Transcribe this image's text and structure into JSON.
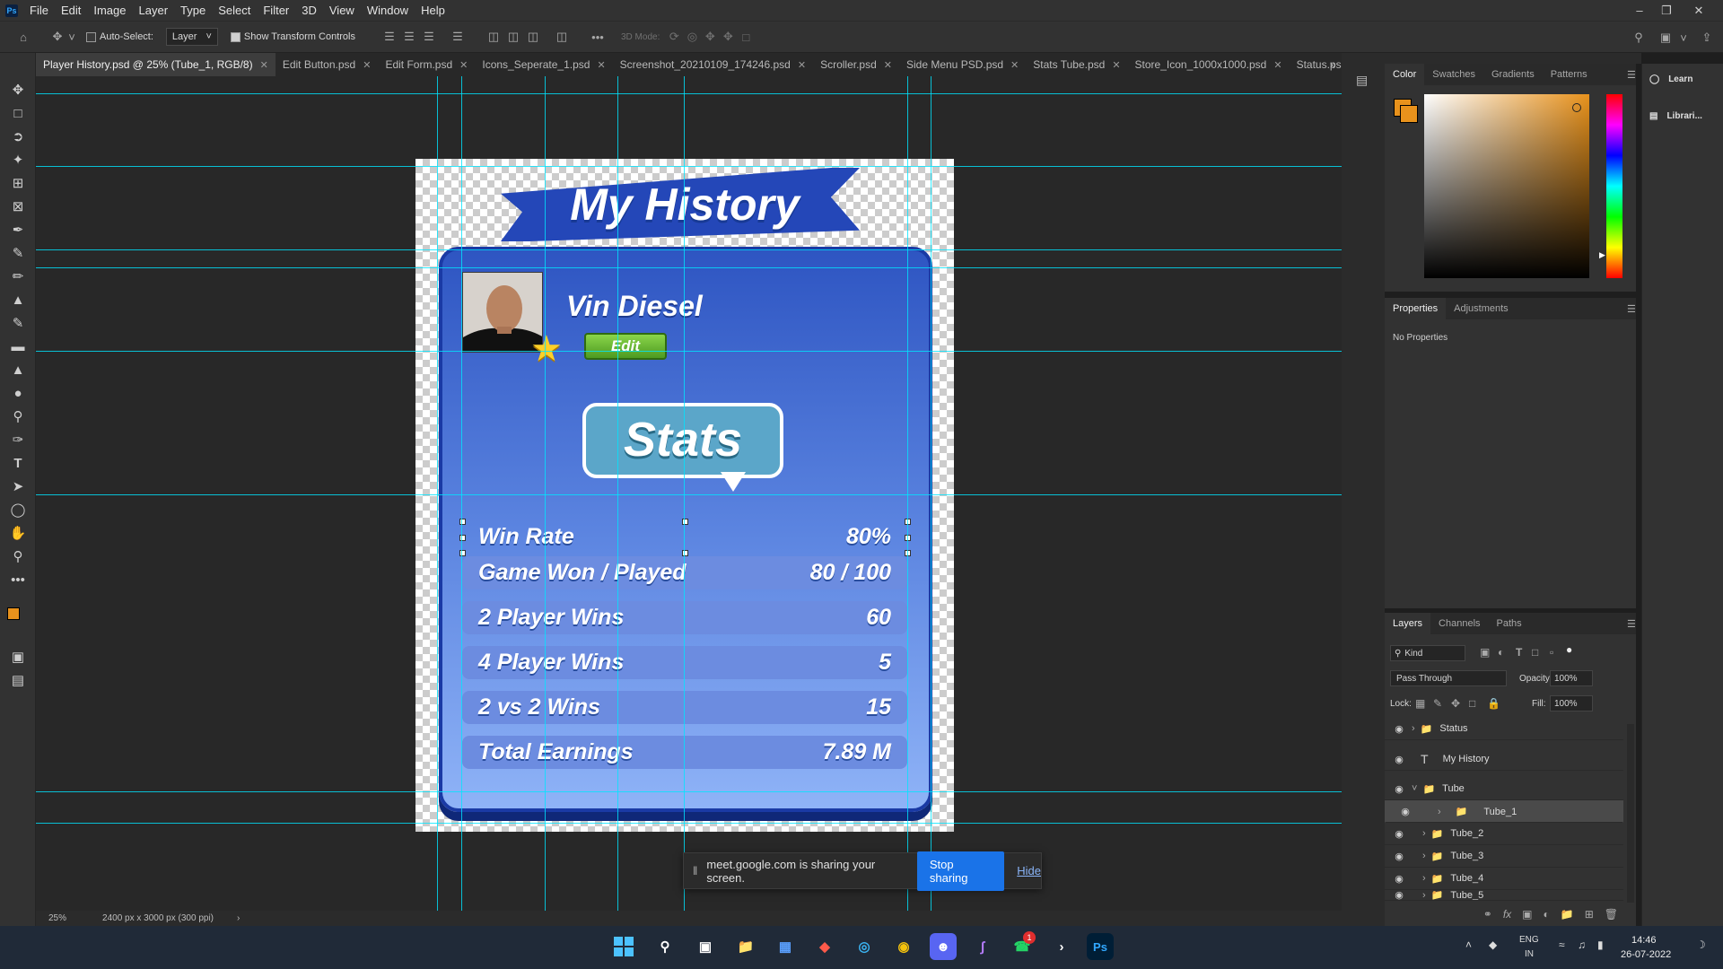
{
  "menubar": {
    "items": [
      "File",
      "Edit",
      "Image",
      "Layer",
      "Type",
      "Select",
      "Filter",
      "3D",
      "View",
      "Window",
      "Help"
    ],
    "logo": "Ps"
  },
  "options": {
    "auto_select_label": "Auto-Select:",
    "auto_select_checked": false,
    "target": "Layer",
    "show_transform_label": "Show Transform Controls",
    "show_transform_checked": true,
    "mode_3d_label": "3D Mode:"
  },
  "tabs": [
    {
      "label": "Player History.psd @ 25% (Tube_1, RGB/8)",
      "active": true
    },
    {
      "label": "Edit Button.psd"
    },
    {
      "label": "Edit Form.psd"
    },
    {
      "label": "Icons_Seperate_1.psd"
    },
    {
      "label": "Screenshot_20210109_174246.psd"
    },
    {
      "label": "Scroller.psd"
    },
    {
      "label": "Side Menu PSD.psd"
    },
    {
      "label": "Stats Tube.psd"
    },
    {
      "label": "Store_Icon_1000x1000.psd"
    },
    {
      "label": "Status.psd"
    }
  ],
  "document": {
    "title": "My History",
    "player_name": "Vin Diesel",
    "edit_label": "Edit",
    "stats_label": "Stats",
    "stats": [
      {
        "label": "Win Rate",
        "value": "80%"
      },
      {
        "label": "Game Won / Played",
        "value": "80 / 100"
      },
      {
        "label": "2 Player Wins",
        "value": "60"
      },
      {
        "label": "4 Player Wins",
        "value": "5"
      },
      {
        "label": "2 vs 2 Wins",
        "value": "15"
      },
      {
        "label": "Total Earnings",
        "value": "7.89 M"
      }
    ]
  },
  "statusbar": {
    "zoom": "25%",
    "doc_size": "2400 px x 3000 px (300 ppi)"
  },
  "color_panel": {
    "tabs": [
      "Color",
      "Swatches",
      "Gradients",
      "Patterns"
    ],
    "foreground": "#e8921c"
  },
  "properties_panel": {
    "tabs": [
      "Properties",
      "Adjustments"
    ],
    "empty_text": "No Properties"
  },
  "learn_panel": {
    "items": [
      "Learn",
      "Librari..."
    ]
  },
  "layers_panel": {
    "tabs": [
      "Layers",
      "Channels",
      "Paths"
    ],
    "filter_kind": "Kind",
    "blend_mode": "Pass Through",
    "opacity_label": "Opacity:",
    "opacity": "100%",
    "lock_label": "Lock:",
    "fill_label": "Fill:",
    "fill": "100%",
    "layers": [
      {
        "name": "Status",
        "type": "group"
      },
      {
        "name": "My History",
        "type": "text"
      },
      {
        "name": "Tube",
        "type": "group-open"
      },
      {
        "name": "Tube_1",
        "type": "group",
        "selected": true
      },
      {
        "name": "Tube_2",
        "type": "group"
      },
      {
        "name": "Tube_3",
        "type": "group"
      },
      {
        "name": "Tube_4",
        "type": "group"
      },
      {
        "name": "Tube_5",
        "type": "group"
      }
    ]
  },
  "sharebar": {
    "message": "meet.google.com is sharing your screen.",
    "stop_label": "Stop sharing",
    "hide_label": "Hide"
  },
  "taskbar": {
    "lang_line1": "ENG",
    "lang_line2": "IN",
    "time": "14:46",
    "date": "26-07-2022",
    "whatsapp_badge": "1"
  }
}
